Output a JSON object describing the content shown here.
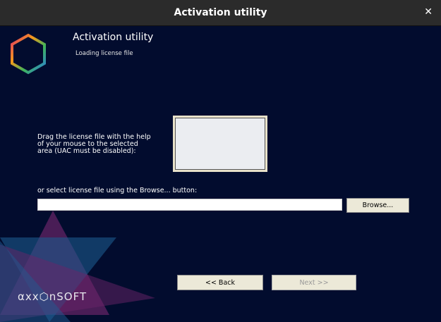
{
  "window": {
    "title": "Activation utility",
    "close_icon": "close-icon"
  },
  "header": {
    "title": "Activation utility",
    "subtitle": "Loading license file"
  },
  "drag_label": [
    "Drag the license file with the help",
    "of your mouse to the selected",
    "area (UAC must be disabled):"
  ],
  "browse_label": "or select license file using the Browse... button:",
  "file_input": {
    "value": ""
  },
  "buttons": {
    "browse": "Browse...",
    "back": "<< Back",
    "next": "Next >>"
  },
  "brand": {
    "logo_text": "axxonsoft"
  }
}
